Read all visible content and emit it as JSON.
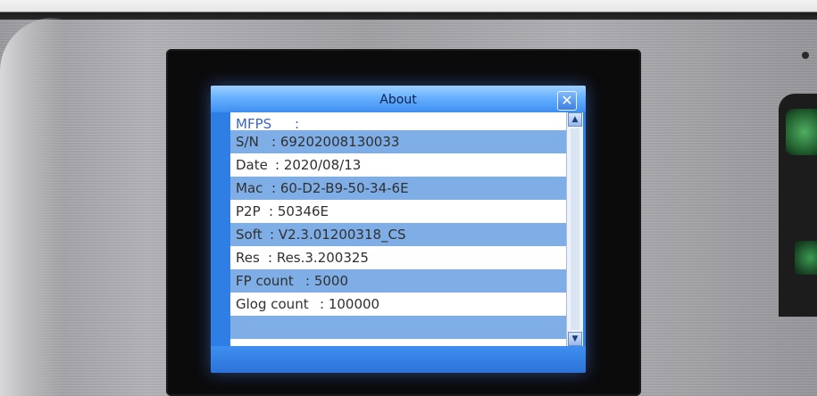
{
  "window": {
    "title": "About",
    "close_glyph": "✕"
  },
  "info_rows": [
    {
      "label": "MFPS",
      "value": ":"
    },
    {
      "label": "S/N",
      "value": ": 69202008130033"
    },
    {
      "label": "Date",
      "value": ": 2020/08/13"
    },
    {
      "label": "Mac",
      "value": ": 60-D2-B9-50-34-6E"
    },
    {
      "label": "P2P",
      "value": ": 50346E"
    },
    {
      "label": "Soft",
      "value": ": V2.3.01200318_CS"
    },
    {
      "label": "Res",
      "value": ": Res.3.200325"
    },
    {
      "label": "FP count",
      "value": ": 5000"
    },
    {
      "label": "Glog count",
      "value": ": 100000"
    }
  ],
  "scrollbar": {
    "up_glyph": "▲",
    "down_glyph": "▼"
  },
  "colors": {
    "screen_blue": "#2f7ee6",
    "row_stripe": "#7faee6",
    "header_text": "#3a63c8"
  }
}
